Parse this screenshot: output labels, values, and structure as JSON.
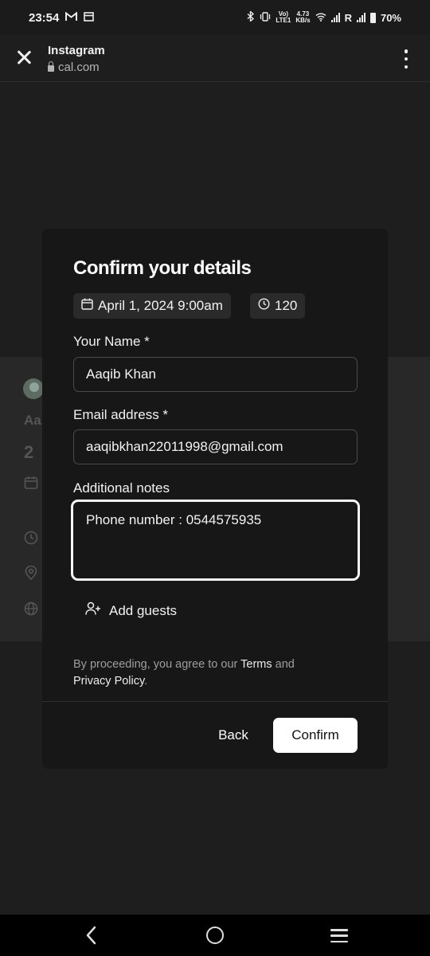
{
  "status_bar": {
    "time": "23:54",
    "speed_top": "4.73",
    "speed_bottom": "KB/s",
    "volte_top": "Vo)",
    "volte_bottom": "LTE1",
    "roaming": "R",
    "battery": "70%"
  },
  "browser": {
    "title": "Instagram",
    "url": "cal.com"
  },
  "background_page": {
    "name_fragment": "Aa",
    "number_fragment": "2"
  },
  "modal": {
    "title": "Confirm your details",
    "date_chip": "April 1, 2024 9:00am",
    "duration_chip": "120",
    "name_label": "Your Name *",
    "name_value": "Aaqib Khan",
    "email_label": "Email address *",
    "email_value": "aaqibkhan22011998@gmail.com",
    "notes_label": "Additional notes",
    "notes_value": "Phone number : 0544575935",
    "add_guests": "Add guests",
    "terms_prefix": "By proceeding, you agree to our ",
    "terms_link": "Terms",
    "terms_and": " and",
    "privacy_link": "Privacy Policy",
    "terms_suffix": ".",
    "back_label": "Back",
    "confirm_label": "Confirm"
  },
  "colors": {
    "modal_bg": "#171717",
    "page_bg": "#202020",
    "accent_button": "#ffffff"
  }
}
